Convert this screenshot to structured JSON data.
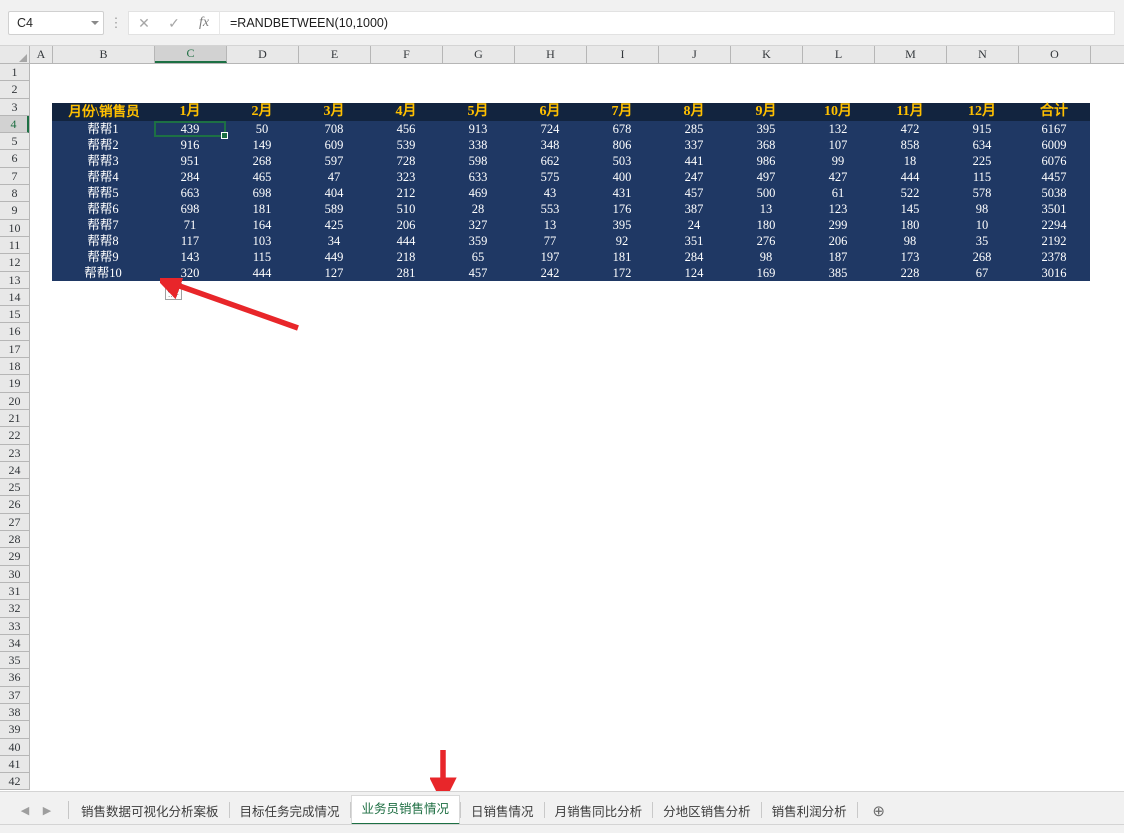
{
  "formula_bar": {
    "name_box_value": "C4",
    "cancel_icon": "✕",
    "confirm_icon": "✓",
    "function_icon": "fx",
    "more_icon": "⋮",
    "formula_value": "=RANDBETWEEN(10,1000)"
  },
  "grid": {
    "columns": [
      "A",
      "B",
      "C",
      "D",
      "E",
      "F",
      "G",
      "H",
      "I",
      "J",
      "K",
      "L",
      "M",
      "N",
      "O"
    ],
    "active_column": "C",
    "active_row": 4,
    "rows": [
      1,
      2,
      3,
      4,
      5,
      6,
      7,
      8,
      9,
      10,
      11,
      12,
      13,
      14,
      15,
      16,
      17,
      18,
      19,
      20,
      21,
      22,
      23,
      24,
      25,
      26,
      27,
      28,
      29,
      30,
      31,
      32,
      33,
      34,
      35,
      36,
      37,
      38,
      39,
      40,
      41,
      42
    ]
  },
  "table": {
    "headers": [
      "月份\\销售员",
      "1月",
      "2月",
      "3月",
      "4月",
      "5月",
      "6月",
      "7月",
      "8月",
      "9月",
      "10月",
      "11月",
      "12月",
      "合计"
    ],
    "rows": [
      {
        "label": "帮帮1",
        "values": [
          439,
          50,
          708,
          456,
          913,
          724,
          678,
          285,
          395,
          132,
          472,
          915
        ],
        "total": 6167
      },
      {
        "label": "帮帮2",
        "values": [
          916,
          149,
          609,
          539,
          338,
          348,
          806,
          337,
          368,
          107,
          858,
          634
        ],
        "total": 6009
      },
      {
        "label": "帮帮3",
        "values": [
          951,
          268,
          597,
          728,
          598,
          662,
          503,
          441,
          986,
          99,
          18,
          225
        ],
        "total": 6076
      },
      {
        "label": "帮帮4",
        "values": [
          284,
          465,
          47,
          323,
          633,
          575,
          400,
          247,
          497,
          427,
          444,
          115
        ],
        "total": 4457
      },
      {
        "label": "帮帮5",
        "values": [
          663,
          698,
          404,
          212,
          469,
          43,
          431,
          457,
          500,
          61,
          522,
          578
        ],
        "total": 5038
      },
      {
        "label": "帮帮6",
        "values": [
          698,
          181,
          589,
          510,
          28,
          553,
          176,
          387,
          13,
          123,
          145,
          98
        ],
        "total": 3501
      },
      {
        "label": "帮帮7",
        "values": [
          71,
          164,
          425,
          206,
          327,
          13,
          395,
          24,
          180,
          299,
          180,
          10
        ],
        "total": 2294
      },
      {
        "label": "帮帮8",
        "values": [
          117,
          103,
          34,
          444,
          359,
          77,
          92,
          351,
          276,
          206,
          98,
          35
        ],
        "total": 2192
      },
      {
        "label": "帮帮9",
        "values": [
          143,
          115,
          449,
          218,
          65,
          197,
          181,
          284,
          98,
          187,
          173,
          268
        ],
        "total": 2378
      },
      {
        "label": "帮帮10",
        "values": [
          320,
          444,
          127,
          281,
          457,
          242,
          172,
          124,
          169,
          385,
          228,
          67
        ],
        "total": 3016
      }
    ],
    "colors": {
      "header_bg": "#12243f",
      "header_text": "#ffc000",
      "body_bg": "#1f3864",
      "body_text": "#ffffff",
      "selection_border": "#1d7044"
    }
  },
  "smart_tag": {
    "name": "paste-options-icon"
  },
  "annotations": {
    "arrow_color": "#e8262a",
    "grid_arrow_label": "fill-handle-pointer",
    "tab_arrow_label": "active-sheet-pointer"
  },
  "sheet_tabs": {
    "nav_first_icon": "◀",
    "nav_prev_icon": "▶",
    "items": [
      {
        "label": "销售数据可视化分析案板",
        "active": false
      },
      {
        "label": "目标任务完成情况",
        "active": false
      },
      {
        "label": "业务员销售情况",
        "active": true
      },
      {
        "label": "日销售情况",
        "active": false
      },
      {
        "label": "月销售同比分析",
        "active": false
      },
      {
        "label": "分地区销售分析",
        "active": false
      },
      {
        "label": "销售利润分析",
        "active": false
      }
    ],
    "add_sheet_icon": "⊕"
  }
}
